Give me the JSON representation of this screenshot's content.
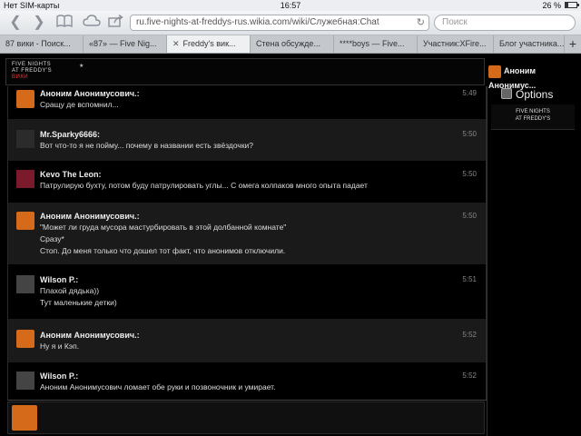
{
  "status": {
    "carrier": "Нет SIM-карты",
    "time": "16:57",
    "battery": "26 %",
    "battery_level": 0.26
  },
  "toolbar": {
    "back_icon": "back-arrow-icon",
    "forward_icon": "forward-arrow-icon",
    "bookmarks_icon": "book-icon",
    "icloud_icon": "cloud-icon",
    "share_icon": "share-icon",
    "url": "ru.five-nights-at-freddys-rus.wikia.com/wiki/Служебная:Chat",
    "search_placeholder": "Поиск"
  },
  "tabs": [
    {
      "label": "87 вики - Поиск..."
    },
    {
      "label": "«87» — Five Nig..."
    },
    {
      "label": "Freddy's вик..."
    },
    {
      "label": "Стена обсужде..."
    },
    {
      "label": "****boys — Five..."
    },
    {
      "label": "Участник:XFire..."
    },
    {
      "label": "Блог участника..."
    }
  ],
  "header": {
    "logo_line1": "FIVE NIGHTS",
    "logo_line2": "AT FREDDY'S",
    "logo_wiki": "ВИКИ"
  },
  "user": {
    "name": "Аноним Анонимус..."
  },
  "sidebar": {
    "options_label": "Options",
    "logo_line1": "FIVE NIGHTS",
    "logo_line2": "AT FREDDY'S"
  },
  "messages": [
    {
      "name": "Аноним Анонимусович.:",
      "time": "5:49",
      "avatar": "star",
      "lines": [
        "Сращу де вспомнил..."
      ]
    },
    {
      "name": "Mr.Sparky6666:",
      "time": "5:50",
      "avatar": "dark",
      "lines": [
        "Вот что-то я не пойму... почему в названии есть звёздочки?"
      ]
    },
    {
      "name": "Kevo The Leon:",
      "time": "5:50",
      "avatar": "red",
      "lines": [
        "Патрулирую бухту, потом буду патрулировать углы... С омега колпаков много опыта падает"
      ]
    },
    {
      "name": "Аноним Анонимусович.:",
      "time": "5:50",
      "avatar": "star",
      "lines": [
        "\"Может ли груда мусора мастурбировать в этой долбанной комнате\"",
        "Сразу*",
        "Стоп. До меня только что дошел тот факт, что анонимов отключили."
      ]
    },
    {
      "name": "Wilson P.:",
      "time": "5:51",
      "avatar": "mono",
      "lines": [
        "Плахой дядька))",
        "Тут маленькие детки)"
      ]
    },
    {
      "name": "Аноним Анонимусович.:",
      "time": "5:52",
      "avatar": "star",
      "lines": [
        "Ну я и Кэп."
      ]
    },
    {
      "name": "Wilson P.:",
      "time": "5:52",
      "avatar": "mono",
      "lines": [
        "Аноним Анонимусович ломает обе руки и позвоночник и умирает."
      ]
    }
  ]
}
